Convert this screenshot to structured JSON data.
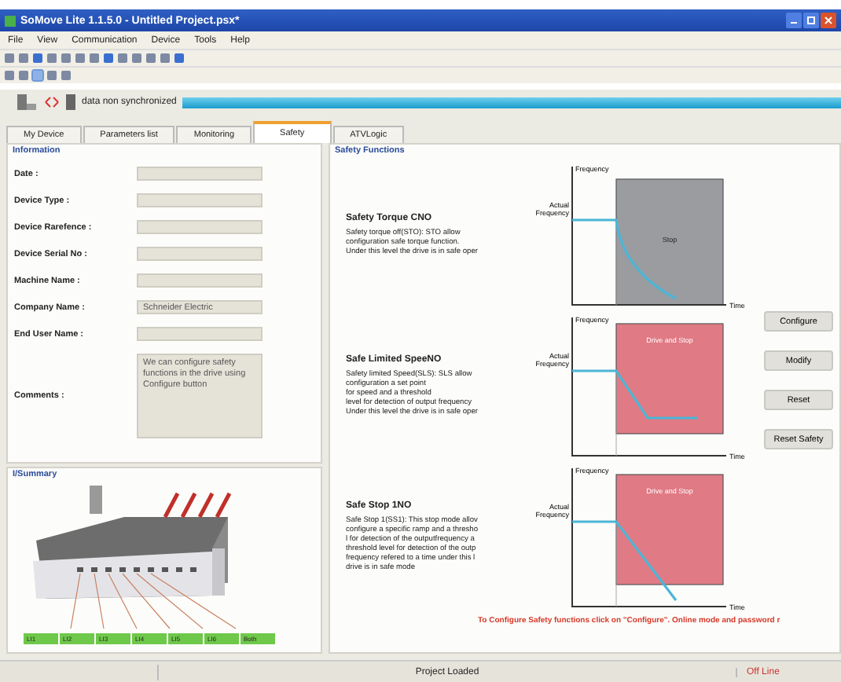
{
  "window": {
    "title": "SoMove Lite 1.1.5.0 - Untitled Project.psx*"
  },
  "menu": [
    "File",
    "View",
    "Communication",
    "Device",
    "Tools",
    "Help"
  ],
  "sync_status": "data non synchronized",
  "tabs": [
    {
      "label": "My Device",
      "selected": false
    },
    {
      "label": "Parameters list",
      "selected": false
    },
    {
      "label": "Monitoring",
      "selected": false
    },
    {
      "label": "Safety",
      "selected": true
    },
    {
      "label": "ATVLogic",
      "selected": false
    }
  ],
  "information": {
    "title": "Information",
    "fields": [
      {
        "label": "Date :"
      },
      {
        "label": "Device Type :"
      },
      {
        "label": "Device Rarefence :"
      },
      {
        "label": "Device Serial No :"
      },
      {
        "label": "Machine Name :"
      },
      {
        "label": "Company Name :",
        "value": "Schneider Electric"
      },
      {
        "label": "End User Name :"
      }
    ],
    "comments": {
      "label": "Comments :",
      "value": "We can configure safety functions in the drive using Configure button"
    }
  },
  "summary": {
    "title": "I/Summary",
    "terminals": [
      "LI1",
      "LI2",
      "LI3",
      "LI4",
      "LI5",
      "LI6",
      "Both"
    ]
  },
  "safety": {
    "title": "Safety Functions",
    "functions": [
      {
        "kind": "sto",
        "title": "Safety Torque CNO",
        "lines": [
          "Safety torque off(STO): STO allow",
          "configuration safe torque function.",
          "Under this level the drive is in safe oper"
        ],
        "y_label": "Frequency",
        "level_label": "Actual Frequency",
        "x_label": "Time",
        "zone_label": "Stop"
      },
      {
        "kind": "sls",
        "title": "Safe Limited SpeeNO",
        "lines": [
          "Safety limited Speed(SLS): SLS allow",
          "configuration a set point",
          "for speed and a threshold",
          "level for detection of output frequency",
          "Under this level the drive is in safe oper"
        ],
        "y_label": "Frequency",
        "level_label": "Actual Frequency",
        "x_label": "Time",
        "zone_label": "Drive and Stop"
      },
      {
        "kind": "ss1",
        "title": "Safe Stop 1NO",
        "lines": [
          "Safe Stop 1(SS1): This stop mode allov",
          "configure a specific ramp and a thresho",
          "l for detection of the outputfrequency a",
          "threshold level for detection of the outp",
          "frequency refered to a time under this l",
          "drive is in safe mode"
        ],
        "y_label": "Frequency",
        "level_label": "Actual Frequency",
        "x_label": "Time",
        "zone_label": "Drive and Stop"
      }
    ],
    "buttons": [
      "Configure",
      "Modify",
      "Reset",
      "Reset Safety"
    ],
    "note": "To Configure Safety functions click on \"Configure\". Online mode and password r"
  },
  "status_bar": {
    "message": "Project Loaded",
    "mode": "Off Line"
  }
}
